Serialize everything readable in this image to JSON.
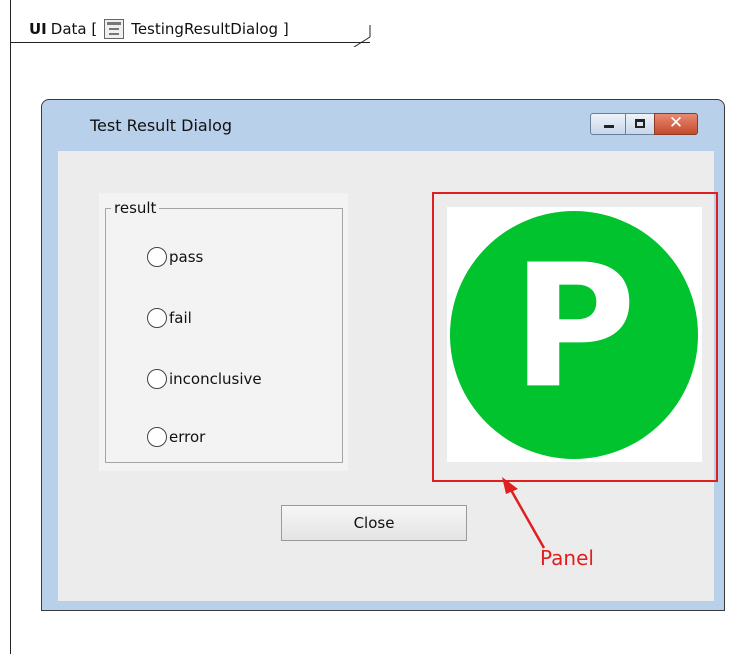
{
  "frame": {
    "keyword": "UI",
    "label": "Data [",
    "element_name": "TestingResultDialog ]",
    "icon": "form-icon"
  },
  "window": {
    "title": "Test Result Dialog",
    "buttons": {
      "minimize": "minimize-icon",
      "maximize": "maximize-icon",
      "close": "close-icon"
    }
  },
  "result_group": {
    "legend": "result",
    "options": [
      {
        "label": "pass"
      },
      {
        "label": "fail"
      },
      {
        "label": "inconclusive"
      },
      {
        "label": "error"
      }
    ]
  },
  "panel": {
    "indicator_letter": "P",
    "indicator_color": "#00c32e",
    "outline_color": "#e02020"
  },
  "close_button": {
    "label": "Close"
  },
  "annotation": {
    "label": "Panel",
    "color": "#e02020"
  }
}
